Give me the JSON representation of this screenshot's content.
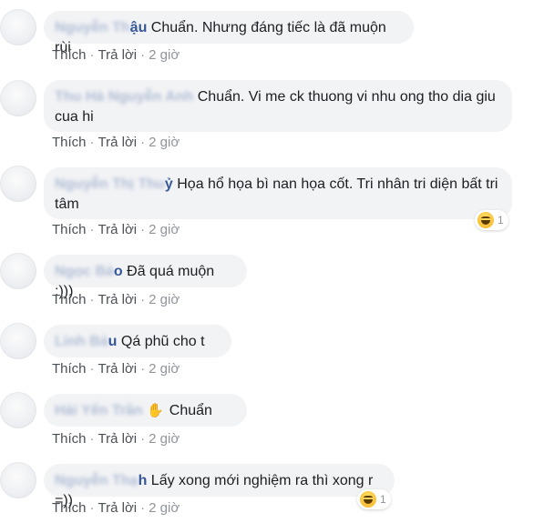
{
  "actions": {
    "like": "Thích",
    "reply": "Trả lời",
    "separator": "·"
  },
  "comments": [
    {
      "author_tail": "ậu",
      "text": "Chuẩn. Nhưng đáng tiếc là đã muộn rùi",
      "time": "2 giờ"
    },
    {
      "author_tail": "",
      "text": "Chuẩn. Vi me ck thuong vi nhu ong tho dia giu cua hi",
      "time": "2 giờ"
    },
    {
      "author_tail": "ỷ",
      "text": "Họa hổ họa bì nan họa cốt. Tri nhân tri diện bất tri tâm",
      "time": "2 giờ",
      "reaction": {
        "type": "haha-icon",
        "count": "1"
      }
    },
    {
      "author_tail": "o",
      "text": "Đã quá muộn :)))",
      "time": "2 giờ"
    },
    {
      "author_tail": "u",
      "text": "Qá phũ cho t",
      "time": "2 giờ"
    },
    {
      "author_tail": "",
      "text": "Chuẩn",
      "time": "2 giờ",
      "prefix_icon": "waving-hand-icon"
    },
    {
      "author_tail": "h",
      "text": "Lấy xong mới nghiệm ra thì xong r =))",
      "time": "2 giờ",
      "reaction": {
        "type": "haha-icon",
        "count": "1"
      }
    }
  ]
}
